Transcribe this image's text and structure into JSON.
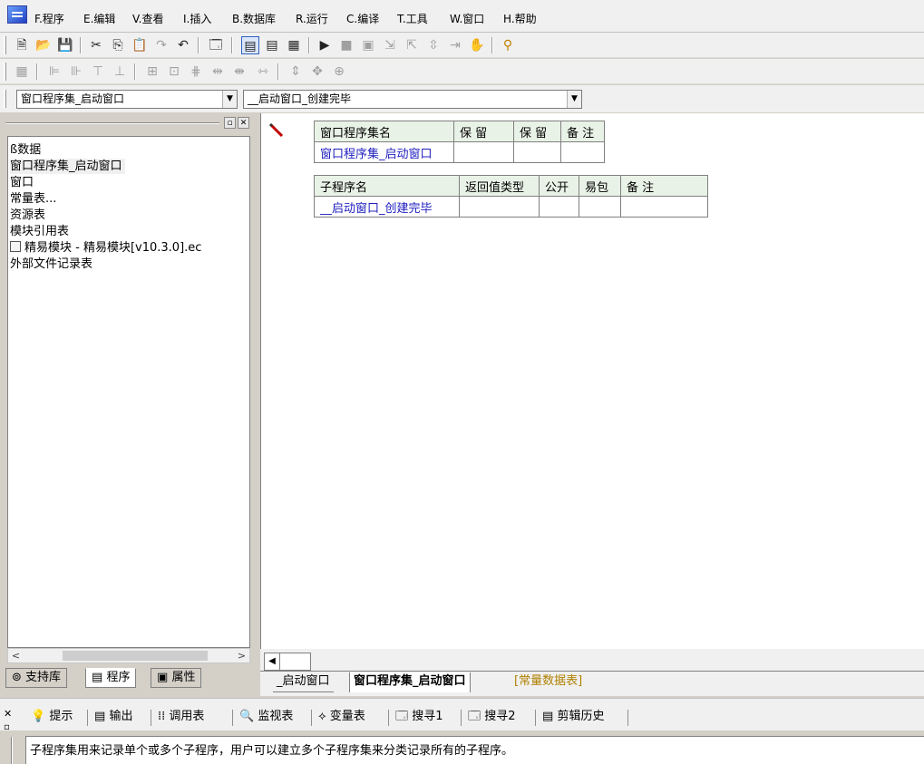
{
  "menu": {
    "items": [
      "F.程序",
      "E.编辑",
      "V.查看",
      "I.插入",
      "B.数据库",
      "R.运行",
      "C.编译",
      "T.工具",
      "W.窗口",
      "H.帮助"
    ]
  },
  "toolbar1": {
    "icons": [
      "new-file-icon",
      "open-folder-icon",
      "save-icon",
      "cut-icon",
      "copy-icon",
      "paste-icon",
      "redo-icon",
      "undo-icon",
      "find-icon",
      "layout1-icon",
      "layout2-icon",
      "layout3-icon",
      "run-icon",
      "stop-icon",
      "debug-icon",
      "step-into-icon",
      "step-over-icon",
      "step-out-icon",
      "run-to-cursor-icon",
      "hand-icon",
      "binoculars-icon"
    ]
  },
  "combos": {
    "assembly": "窗口程序集_启动窗口",
    "subroutine": "__启动窗口_创建完毕"
  },
  "tree": {
    "items": [
      "ß数据",
      "窗口程序集_启动窗口",
      "窗口",
      "常量表...",
      "资源表",
      "模块引用表",
      "精易模块 - 精易模块[v10.3.0].ec",
      "外部文件记录表"
    ]
  },
  "left_tabs": [
    "支持库",
    "程序",
    "属性"
  ],
  "assembly_table": {
    "headers": [
      "窗口程序集名",
      "保 留",
      "保 留",
      "备 注"
    ],
    "row": [
      "窗口程序集_启动窗口",
      "",
      "",
      ""
    ]
  },
  "sub_table": {
    "headers": [
      "子程序名",
      "返回值类型",
      "公开",
      "易包",
      "备 注"
    ],
    "row": [
      "__启动窗口_创建完毕",
      "",
      "",
      "",
      ""
    ]
  },
  "doc_tabs": [
    "_启动窗口",
    "窗口程序集_启动窗口",
    "[常量数据表]"
  ],
  "output_tabs": [
    "提示",
    "输出",
    "调用表",
    "监视表",
    "变量表",
    "搜寻1",
    "搜寻2",
    "剪辑历史"
  ],
  "output_text": "子程序集用来记录单个或多个子程序，用户可以建立多个子程序集来分类记录所有的子程序。",
  "colors": {
    "blue_text": "#2020c0",
    "table_header": "#e9f2e6",
    "const_tab": "#b08000"
  }
}
